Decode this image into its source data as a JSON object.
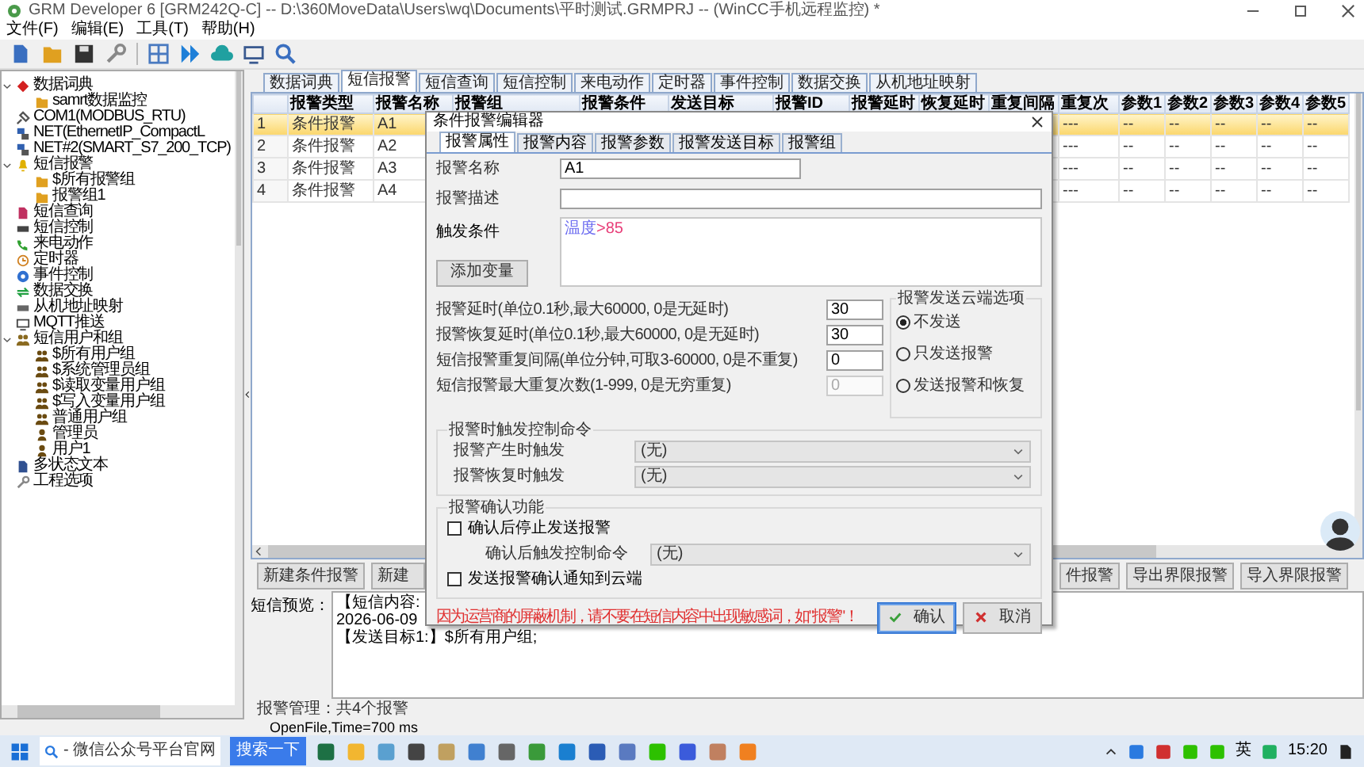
{
  "window": {
    "title": "GRM Developer 6 [GRM242Q-C]  -- D:\\360MoveData\\Users\\wq\\Documents\\平时测试.GRMPRJ -- (WinCC手机远程监控) *"
  },
  "menu": [
    "文件(F)",
    "编辑(E)",
    "工具(T)",
    "帮助(H)"
  ],
  "tree": [
    {
      "label": "数据词典",
      "kind": "dict",
      "expanded": true,
      "children": [
        {
          "label": "samrt数据监控",
          "kind": "monitor"
        }
      ]
    },
    {
      "label": "COM1(MODBUS_RTU)",
      "kind": "serial"
    },
    {
      "label": "NET(EthernetIP_CompactL",
      "kind": "network"
    },
    {
      "label": "NET#2(SMART_S7_200_TCP)",
      "kind": "network"
    },
    {
      "label": "短信报警",
      "kind": "alarm",
      "expanded": true,
      "children": [
        {
          "label": "$所有报警组",
          "kind": "folder"
        },
        {
          "label": "报警组1",
          "kind": "folder"
        }
      ]
    },
    {
      "label": "短信查询",
      "kind": "query"
    },
    {
      "label": "短信控制",
      "kind": "control"
    },
    {
      "label": "来电动作",
      "kind": "phone"
    },
    {
      "label": "定时器",
      "kind": "timer"
    },
    {
      "label": "事件控制",
      "kind": "event"
    },
    {
      "label": "数据交换",
      "kind": "exchange"
    },
    {
      "label": "从机地址映射",
      "kind": "map"
    },
    {
      "label": "MQTT推送",
      "kind": "mqtt"
    },
    {
      "label": "短信用户和组",
      "kind": "users",
      "expanded": true,
      "children": [
        {
          "label": "$所有用户组",
          "kind": "group"
        },
        {
          "label": "$系统管理员组",
          "kind": "group"
        },
        {
          "label": "$读取变量用户组",
          "kind": "group"
        },
        {
          "label": "$写入变量用户组",
          "kind": "group"
        },
        {
          "label": "普通用户组",
          "kind": "group"
        },
        {
          "label": "管理员",
          "kind": "user"
        },
        {
          "label": "用户1",
          "kind": "user"
        }
      ]
    },
    {
      "label": "多状态文本",
      "kind": "text"
    },
    {
      "label": "工程选项",
      "kind": "options"
    }
  ],
  "tabs": [
    {
      "label": "数据词典",
      "selected": false
    },
    {
      "label": "短信报警",
      "selected": true
    },
    {
      "label": "短信查询",
      "selected": false
    },
    {
      "label": "短信控制",
      "selected": false
    },
    {
      "label": "来电动作",
      "selected": false
    },
    {
      "label": "定时器",
      "selected": false
    },
    {
      "label": "事件控制",
      "selected": false
    },
    {
      "label": "数据交换",
      "selected": false
    },
    {
      "label": "从机地址映射",
      "selected": false
    }
  ],
  "table": {
    "columns": [
      "报警类型",
      "报警名称",
      "报警组",
      "报警条件",
      "发送目标",
      "报警ID",
      "报警延时",
      "恢复延时",
      "重复间隔",
      "重复次",
      "参数1",
      "参数2",
      "参数3",
      "参数4",
      "参数5"
    ],
    "rows": [
      {
        "index": "1",
        "selected": true,
        "type": "条件报警",
        "name": "A1",
        "repeat_count": "---",
        "params": [
          "--",
          "--",
          "--",
          "--",
          "--"
        ]
      },
      {
        "index": "2",
        "selected": false,
        "type": "条件报警",
        "name": "A2",
        "repeat_count": "---",
        "params": [
          "--",
          "--",
          "--",
          "--",
          "--"
        ]
      },
      {
        "index": "3",
        "selected": false,
        "type": "条件报警",
        "name": "A3",
        "repeat_count": "---",
        "params": [
          "--",
          "--",
          "--",
          "--",
          "--"
        ]
      },
      {
        "index": "4",
        "selected": false,
        "type": "条件报警",
        "name": "A4",
        "repeat_count": "---",
        "params": [
          "--",
          "--",
          "--",
          "--",
          "--"
        ]
      }
    ]
  },
  "buttons_left": [
    "新建条件报警",
    "新建"
  ],
  "buttons_right": [
    "件报警",
    "导出界限报警",
    "导入界限报警"
  ],
  "preview": {
    "label": "短信预览：",
    "lines": [
      "【短信内容:",
      "2026-06-09",
      "【发送目标1:】$所有用户组;"
    ]
  },
  "summary": "报警管理：共4个报警",
  "status": "OpenFile,Time=700 ms",
  "dialog": {
    "title": "条件报警编辑器",
    "tabs": [
      {
        "label": "报警属性",
        "selected": true
      },
      {
        "label": "报警内容",
        "selected": false
      },
      {
        "label": "报警参数",
        "selected": false
      },
      {
        "label": "报警发送目标",
        "selected": false
      },
      {
        "label": "报警组",
        "selected": false
      }
    ],
    "name": {
      "label": "报警名称",
      "value": "A1"
    },
    "description": {
      "label": "报警描述"
    },
    "condition": {
      "label": "触发条件",
      "tokens": [
        {
          "text": "温度",
          "color": "#6a6af0"
        },
        {
          "text": ">85",
          "color": "#e8407a"
        }
      ]
    },
    "add_variable": "添加变量",
    "timing": [
      {
        "label": "报警延时(单位0.1秒,最大60000, 0是无延时)",
        "value": "30",
        "disabled": false
      },
      {
        "label": "报警恢复延时(单位0.1秒,最大60000, 0是无延时)",
        "value": "30",
        "disabled": false
      },
      {
        "label": "短信报警重复间隔(单位分钟,可取3-60000, 0是不重复)",
        "value": "0",
        "disabled": false
      },
      {
        "label": "短信报警最大重复次数(1-999, 0是无穷重复)",
        "value": "0",
        "disabled": true
      }
    ],
    "cloud": {
      "title": "报警发送云端选项",
      "options": [
        {
          "label": "不发送",
          "selected": true
        },
        {
          "label": "只发送报警",
          "selected": false
        },
        {
          "label": "发送报警和恢复",
          "selected": false
        }
      ]
    },
    "trigger": {
      "title": "报警时触发控制命令",
      "rows": [
        {
          "label": "报警产生时触发",
          "value": "(无)"
        },
        {
          "label": "报警恢复时触发",
          "value": "(无)"
        }
      ]
    },
    "confirm": {
      "title": "报警确认功能",
      "items": [
        {
          "kind": "checkbox",
          "label": "确认后停止发送报警",
          "checked": false
        },
        {
          "kind": "select",
          "label": "确认后触发控制命令",
          "value": "(无)"
        },
        {
          "kind": "checkbox",
          "label": "发送报警确认通知到云端",
          "checked": false
        }
      ]
    },
    "warning": "因为运营商的屏蔽机制，请不要在短信内容中出现敏感词，如\"报警\"！",
    "ok": {
      "label": "确认",
      "default": true
    },
    "cancel": {
      "label": "取消",
      "default": false
    }
  },
  "taskbar": {
    "search": "- 微信公众号平台官网",
    "search_button": "搜索一下",
    "language": "英",
    "clock": "15:20"
  }
}
